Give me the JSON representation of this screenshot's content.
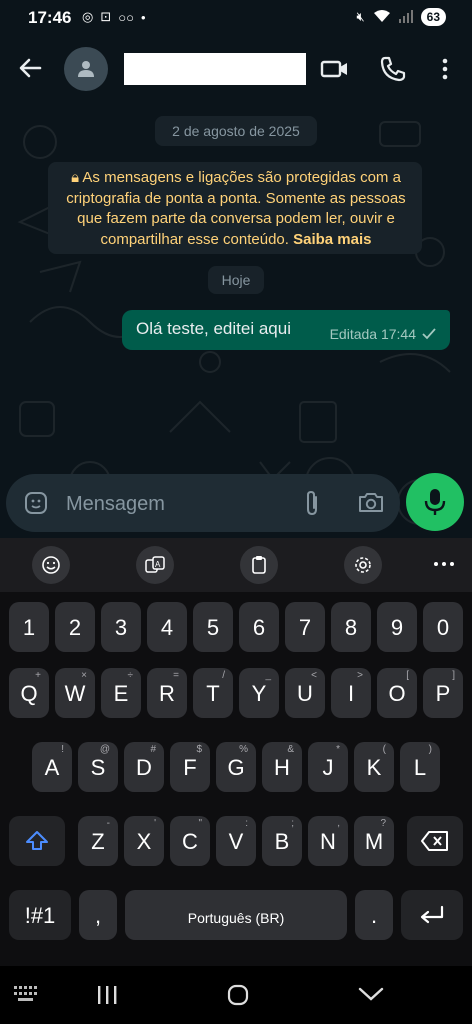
{
  "status_bar": {
    "time": "17:46",
    "battery": "63"
  },
  "header": {
    "icons": [
      "back-arrow-icon",
      "avatar-person-icon",
      "video-call-icon",
      "phone-call-icon",
      "more-vertical-icon"
    ]
  },
  "chat": {
    "date_chip": "2 de agosto de 2025",
    "encryption_notice": "As mensagens e ligações são protegidas com a criptografia de ponta a ponta. Somente as pessoas que fazem parte da conversa podem ler, ouvir e compartilhar esse conteúdo.",
    "encryption_link": "Saiba mais",
    "today_chip": "Hoje",
    "message": {
      "text": "Olá teste, editei aqui",
      "meta": "Editada 17:44",
      "status_icon": "check-sent-icon"
    }
  },
  "composer": {
    "placeholder": "Mensagem",
    "icons": [
      "sticker-icon",
      "attach-clip-icon",
      "camera-icon",
      "microphone-icon"
    ]
  },
  "keyboard": {
    "toolbar_icons": [
      "emoji-icon",
      "translate-icon",
      "clipboard-icon",
      "settings-icon",
      "more-horizontal-icon"
    ],
    "row_numbers": [
      "1",
      "2",
      "3",
      "4",
      "5",
      "6",
      "7",
      "8",
      "9",
      "0"
    ],
    "row1": [
      [
        "Q",
        "+"
      ],
      [
        "W",
        "×"
      ],
      [
        "E",
        "÷"
      ],
      [
        "R",
        "="
      ],
      [
        "T",
        "/"
      ],
      [
        "Y",
        "_"
      ],
      [
        "U",
        "<"
      ],
      [
        "I",
        ">"
      ],
      [
        "O",
        "["
      ],
      [
        "P",
        "]"
      ]
    ],
    "row2": [
      [
        "A",
        "!"
      ],
      [
        "S",
        "@"
      ],
      [
        "D",
        "#"
      ],
      [
        "F",
        "$"
      ],
      [
        "G",
        "%"
      ],
      [
        "H",
        "&"
      ],
      [
        "J",
        "*"
      ],
      [
        "K",
        "("
      ],
      [
        "L",
        ")"
      ]
    ],
    "row3": [
      [
        "Z",
        "-"
      ],
      [
        "X",
        "'"
      ],
      [
        "C",
        "\""
      ],
      [
        "V",
        ":"
      ],
      [
        "B",
        ";"
      ],
      [
        "N",
        ","
      ],
      [
        "M",
        "?"
      ]
    ],
    "symbols_key": "!#1",
    "comma_key": ",",
    "space_key": "Português (BR)",
    "period_key": ".",
    "accent_color": "#21c063"
  },
  "navbar": {
    "icons": [
      "keyboard-grid-icon",
      "recents-icon",
      "home-icon",
      "back-chevron-icon"
    ]
  }
}
